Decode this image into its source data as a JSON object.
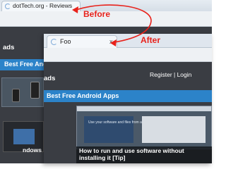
{
  "before_window": {
    "tab_title": "dotTech.org - Reviews",
    "site_title": "ads",
    "category_bar": "Best Free Android Apps",
    "bottom_text": "ndows"
  },
  "after_window": {
    "tab_title": "Foo",
    "tab_close": "x",
    "site_title": "ads",
    "login_links": "Register | Login",
    "category_bar": "Best Free Android Apps",
    "article_caption": "How to run and use software without installing it [Tip]",
    "screenshot_text": "Use your software and files from anywhere on the go"
  },
  "annotations": {
    "before_label": "Before",
    "after_label": "After",
    "color": "#e8221b"
  },
  "icons": [
    "page-loading-icon",
    "tab-close-icon"
  ]
}
